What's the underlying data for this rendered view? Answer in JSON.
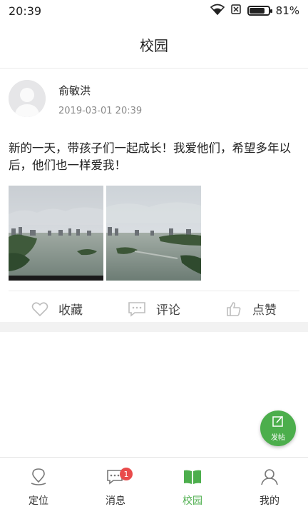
{
  "status_bar": {
    "time": "20:39",
    "battery_text": "81%",
    "battery_level": 0.81,
    "icons": [
      "wifi-icon",
      "sim-off-icon",
      "battery-icon"
    ]
  },
  "header": {
    "title": "校园"
  },
  "post": {
    "author": "俞敏洪",
    "time": "2019-03-01 20:39",
    "text": "新的一天，带孩子们一起成长！我爱他们，希望多年以后，他们也一样爱我！",
    "photos": [
      "lake-photo-1",
      "lake-photo-2"
    ],
    "actions": [
      {
        "label": "收藏",
        "icon": "heart-icon"
      },
      {
        "label": "评论",
        "icon": "comment-icon"
      },
      {
        "label": "点赞",
        "icon": "thumb-up-icon"
      }
    ]
  },
  "fab": {
    "label": "发帖",
    "icon": "edit-icon"
  },
  "tabbar": {
    "active": "校园",
    "accent": "#4cae4c",
    "items": [
      {
        "label": "定位",
        "icon": "location-icon"
      },
      {
        "label": "消息",
        "icon": "message-icon",
        "badge": "1"
      },
      {
        "label": "校园",
        "icon": "book-icon"
      },
      {
        "label": "我的",
        "icon": "person-icon"
      }
    ]
  }
}
